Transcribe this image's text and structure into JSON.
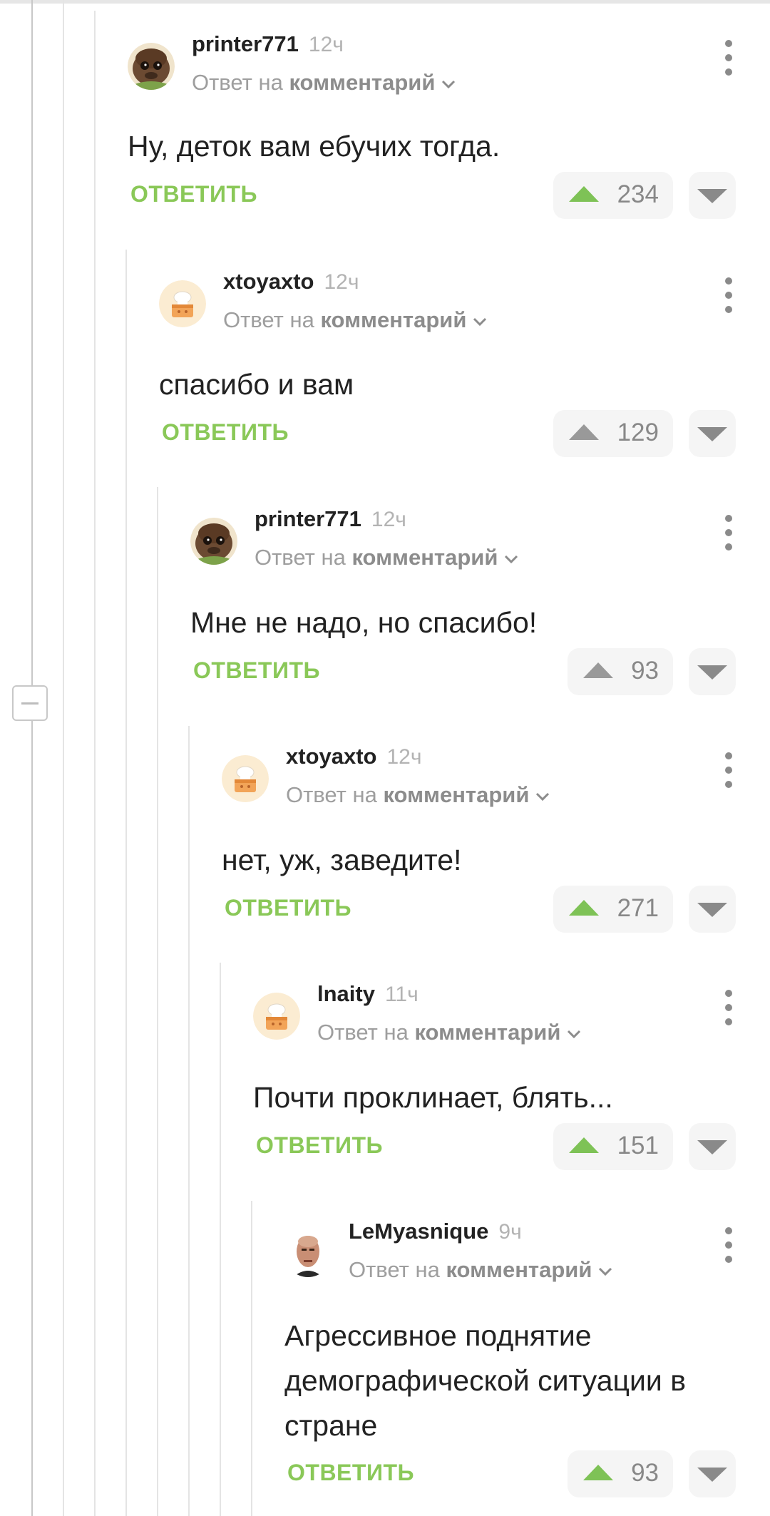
{
  "comments": [
    {
      "user": "printer771",
      "time": "12ч",
      "reply_prefix": "Ответ на",
      "reply_target": "комментарий",
      "text": "Ну, деток вам ебучих тогда.",
      "reply_label": "ОТВЕТИТЬ",
      "votes": "234",
      "upvoted": true,
      "avatar": "brown-creature"
    },
    {
      "user": "xtoyaxto",
      "time": "12ч",
      "reply_prefix": "Ответ на",
      "reply_target": "комментарий",
      "text": "спасибо и вам",
      "reply_label": "ОТВЕТИТЬ",
      "votes": "129",
      "upvoted": false,
      "avatar": "chef-hat-cake"
    },
    {
      "user": "printer771",
      "time": "12ч",
      "reply_prefix": "Ответ на",
      "reply_target": "комментарий",
      "text": "Мне не надо, но спасибо!",
      "reply_label": "ОТВЕТИТЬ",
      "votes": "93",
      "upvoted": false,
      "avatar": "brown-creature"
    },
    {
      "user": "xtoyaxto",
      "time": "12ч",
      "reply_prefix": "Ответ на",
      "reply_target": "комментарий",
      "text": "нет, уж, заведите!",
      "reply_label": "ОТВЕТИТЬ",
      "votes": "271",
      "upvoted": true,
      "avatar": "chef-hat-cake"
    },
    {
      "user": "lnaity",
      "time": "11ч",
      "reply_prefix": "Ответ на",
      "reply_target": "комментарий",
      "text": "Почти проклинает, блять...",
      "reply_label": "ОТВЕТИТЬ",
      "votes": "151",
      "upvoted": true,
      "avatar": "chef-hat-cake"
    },
    {
      "user": "LeMyasnique",
      "time": "9ч",
      "reply_prefix": "Ответ на",
      "reply_target": "комментарий",
      "text_lines": [
        "Агрессивное поднятие",
        "демографической ситуации в",
        "стране"
      ],
      "reply_label": "ОТВЕТИТЬ",
      "votes": "93",
      "upvoted": true,
      "avatar": "bald-man-portrait"
    }
  ],
  "colors": {
    "accent_green": "#8ac858",
    "upvote_green": "#7ec256",
    "thread_line": "#e4e4e4"
  }
}
